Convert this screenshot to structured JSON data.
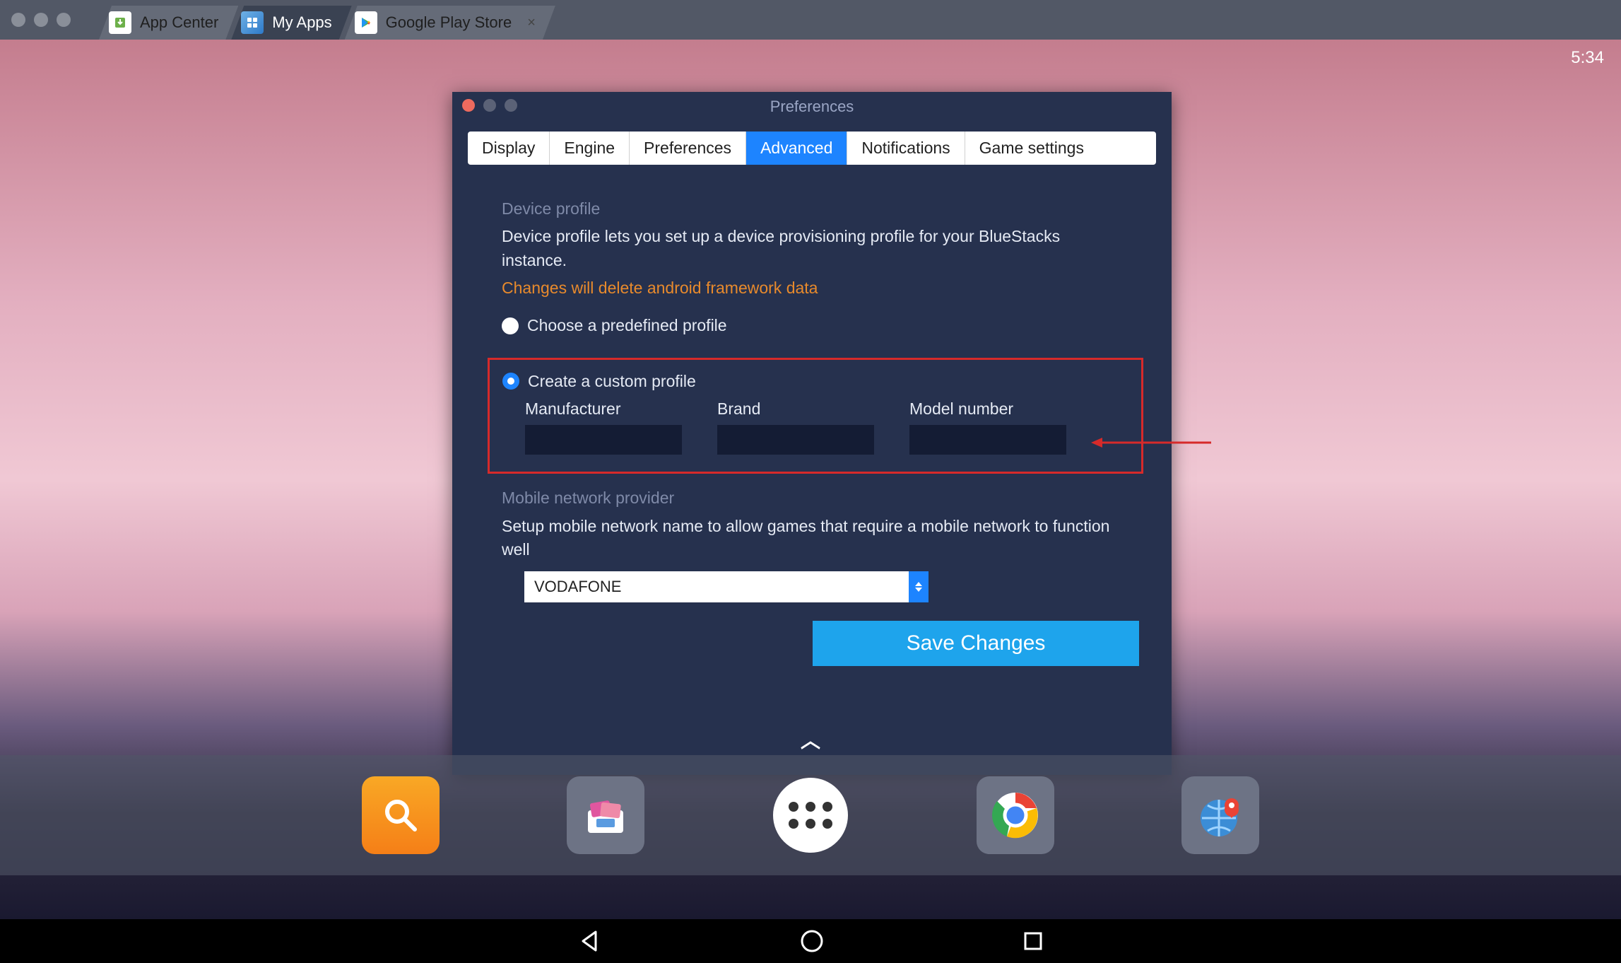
{
  "titlebar": {
    "tabs": [
      {
        "label": "App Center"
      },
      {
        "label": "My Apps"
      },
      {
        "label": "Google Play Store"
      }
    ]
  },
  "clock": "5:34",
  "preferences": {
    "title": "Preferences",
    "tabs": [
      "Display",
      "Engine",
      "Preferences",
      "Advanced",
      "Notifications",
      "Game settings"
    ],
    "active_tab": "Advanced",
    "device_profile": {
      "heading": "Device profile",
      "description": "Device profile lets you set up a device provisioning profile for your BlueStacks instance.",
      "warning": "Changes will delete android framework data",
      "option_predefined": "Choose a predefined profile",
      "option_custom": "Create a custom profile",
      "fields": {
        "manufacturer_label": "Manufacturer",
        "brand_label": "Brand",
        "model_label": "Model number",
        "manufacturer_value": "",
        "brand_value": "",
        "model_value": ""
      }
    },
    "network": {
      "heading": "Mobile network provider",
      "description": "Setup mobile network name to allow games that require a mobile network to function well",
      "selected": "VODAFONE"
    },
    "save_label": "Save Changes"
  }
}
